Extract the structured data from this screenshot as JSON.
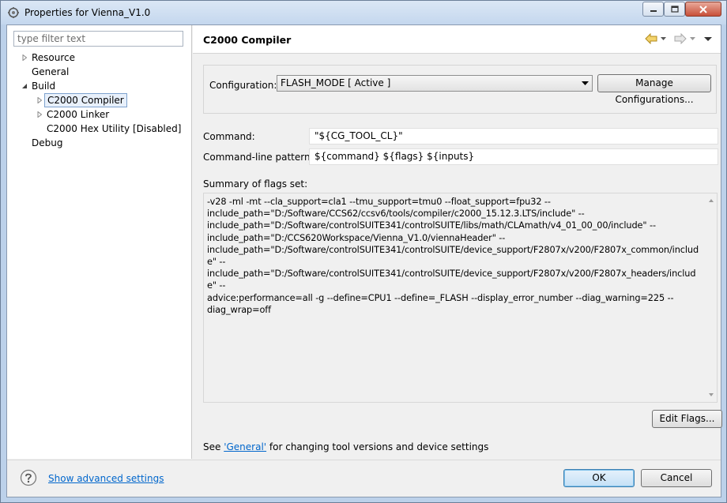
{
  "window": {
    "title": "Properties for Vienna_V1.0"
  },
  "left": {
    "filter_placeholder": "type filter text",
    "tree": [
      {
        "label": "Resource",
        "level": 0,
        "expander": "collapsed"
      },
      {
        "label": "General",
        "level": 0,
        "expander": "none"
      },
      {
        "label": "Build",
        "level": 0,
        "expander": "expanded"
      },
      {
        "label": "C2000 Compiler",
        "level": 1,
        "expander": "collapsed",
        "selected": true
      },
      {
        "label": "C2000 Linker",
        "level": 1,
        "expander": "collapsed"
      },
      {
        "label": "C2000 Hex Utility  [Disabled]",
        "level": 1,
        "expander": "none"
      },
      {
        "label": "Debug",
        "level": 0,
        "expander": "none"
      }
    ]
  },
  "page": {
    "title": "C2000 Compiler",
    "config_label": "Configuration:",
    "config_value": "FLASH_MODE  [ Active ]",
    "manage_button": "Manage Configurations...",
    "command_label": "Command:",
    "command_value": "\"${CG_TOOL_CL}\"",
    "pattern_label": "Command-line pattern:",
    "pattern_value": "${command} ${flags} ${inputs}",
    "summary_label": "Summary of flags set:",
    "summary_text": "-v28 -ml -mt --cla_support=cla1 --tmu_support=tmu0 --float_support=fpu32 --\ninclude_path=\"D:/Software/CCS62/ccsv6/tools/compiler/c2000_15.12.3.LTS/include\" --\ninclude_path=\"D:/Software/controlSUITE341/controlSUITE/libs/math/CLAmath/v4_01_00_00/include\" --\ninclude_path=\"D:/CCS620Workspace/Vienna_V1.0/viennaHeader\" --\ninclude_path=\"D:/Software/controlSUITE341/controlSUITE/device_support/F2807x/v200/F2807x_common/include\" --\ninclude_path=\"D:/Software/controlSUITE341/controlSUITE/device_support/F2807x/v200/F2807x_headers/include\" --\nadvice:performance=all -g --define=CPU1 --define=_FLASH --display_error_number --diag_warning=225 --\ndiag_wrap=off",
    "edit_flags_button": "Edit Flags...",
    "see_prefix": "See ",
    "see_link": "'General'",
    "see_suffix": " for changing tool versions and device settings"
  },
  "footer": {
    "advanced_link": "Show advanced settings",
    "ok_button": "OK",
    "cancel_button": "Cancel"
  },
  "colors": {
    "link": "#0066cc",
    "selection_border": "#7da2ce",
    "selection_fill": "#e8f0fb"
  }
}
